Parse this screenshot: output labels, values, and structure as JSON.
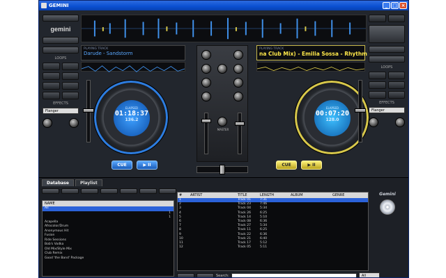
{
  "window": {
    "title": "GEMINI",
    "controls": [
      "_",
      "□",
      "×"
    ]
  },
  "brand": {
    "logo_text": "gemini",
    "sidebar_logo_text": "Gemini"
  },
  "deck_left": {
    "caption": "PLAYING TRACK",
    "track_title": "Darude - Sandstorm",
    "time_caption": "ELAPSED",
    "time": "01:18:37",
    "bpm": "136.2",
    "cue_label": "CUE",
    "play_label": "▶ II",
    "accent_color": "#2d7de0"
  },
  "deck_right": {
    "caption": "PLAYING TRACK",
    "track_title": "na Club Mix) - Emilia Sossa - Rhythm",
    "time_caption": "ELAPSED",
    "time": "00:07:20",
    "bpm": "128.0",
    "cue_label": "CUE",
    "play_label": "▶ II",
    "accent_color": "#d8c84a"
  },
  "left_panel": {
    "loops_label": "LOOPS",
    "effects_label": "EFFECTS",
    "effect_value": "Flanger"
  },
  "right_panel": {
    "loops_label": "LOOPS",
    "effects_label": "EFFECTS",
    "effect_value": "Flanger"
  },
  "mixer": {
    "master_label": "MASTER"
  },
  "browser": {
    "tabs": [
      "Database",
      "Playlist"
    ],
    "active_tab": "Database",
    "folder_header": "NAME",
    "folders": [
      {
        "name": "All",
        "count": "",
        "selected": true
      },
      {
        "name": "",
        "count": "1"
      },
      {
        "name": "",
        "count": "1"
      },
      {
        "name": "Acapella",
        "count": ""
      },
      {
        "name": "Afrocolor/Drum",
        "count": ""
      },
      {
        "name": "Anonymous Hit",
        "count": ""
      },
      {
        "name": "Fusion",
        "count": ""
      },
      {
        "name": "Ride Sessions",
        "count": ""
      },
      {
        "name": "Bob's Vodka",
        "count": ""
      },
      {
        "name": "Old Mix/Style Mix",
        "count": ""
      },
      {
        "name": "Club Remix",
        "count": ""
      },
      {
        "name": "Good 'the Band' Package",
        "count": ""
      }
    ],
    "columns": [
      "#",
      "ARTIST",
      "TITLE",
      "LENGTH",
      "ALBUM",
      "GENRE"
    ],
    "tracks": [
      {
        "num": "1",
        "artist": "",
        "title": "Track 01",
        "length": "7:31",
        "album": "",
        "genre": "",
        "selected": true
      },
      {
        "num": "2",
        "artist": "",
        "title": "Track 23",
        "length": "7:46",
        "album": "",
        "genre": ""
      },
      {
        "num": "3",
        "artist": "",
        "title": "Track 04",
        "length": "5:34",
        "album": "",
        "genre": ""
      },
      {
        "num": "4",
        "artist": "",
        "title": "Track 26",
        "length": "6:25",
        "album": "",
        "genre": ""
      },
      {
        "num": "5",
        "artist": "",
        "title": "Track 14",
        "length": "5:10",
        "album": "",
        "genre": ""
      },
      {
        "num": "6",
        "artist": "",
        "title": "Track 08",
        "length": "6:36",
        "album": "",
        "genre": ""
      },
      {
        "num": "7",
        "artist": "",
        "title": "Track 27",
        "length": "5:34",
        "album": "",
        "genre": ""
      },
      {
        "num": "8",
        "artist": "",
        "title": "Track 11",
        "length": "6:25",
        "album": "",
        "genre": ""
      },
      {
        "num": "9",
        "artist": "",
        "title": "Track 22",
        "length": "6:36",
        "album": "",
        "genre": ""
      },
      {
        "num": "10",
        "artist": "",
        "title": "Track 21",
        "length": "6:40",
        "album": "",
        "genre": ""
      },
      {
        "num": "11",
        "artist": "",
        "title": "Track 17",
        "length": "5:12",
        "album": "",
        "genre": ""
      },
      {
        "num": "12",
        "artist": "",
        "title": "Track 05",
        "length": "5:11",
        "album": "",
        "genre": ""
      }
    ],
    "search_label": "Search:",
    "search_value": "",
    "search_scope": "All"
  }
}
